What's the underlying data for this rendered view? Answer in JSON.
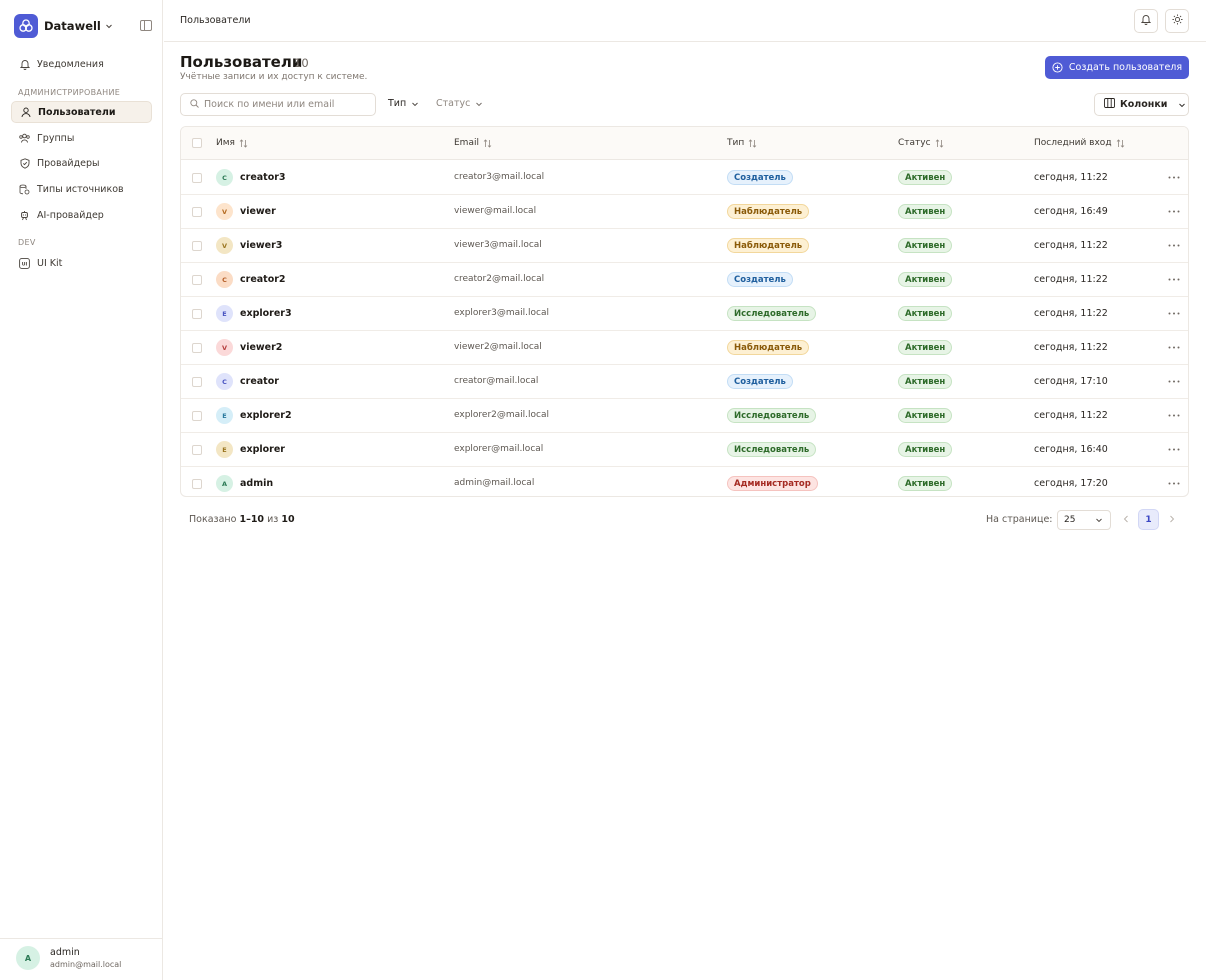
{
  "app": {
    "name": "Datawell"
  },
  "sidebar": {
    "items_top": [
      {
        "label": "Уведомления",
        "icon": "bell-icon"
      }
    ],
    "section_admin": "АДМИНИСТРИРОВАНИЕ",
    "items_admin": [
      {
        "label": "Пользователи",
        "icon": "user-icon",
        "active": true
      },
      {
        "label": "Группы",
        "icon": "group-icon"
      },
      {
        "label": "Провайдеры",
        "icon": "shield-icon"
      },
      {
        "label": "Типы источников",
        "icon": "source-types-icon"
      },
      {
        "label": "AI-провайдер",
        "icon": "ai-icon"
      }
    ],
    "section_dev": "DEV",
    "items_dev": [
      {
        "label": "UI Kit",
        "icon": "ui-kit-icon"
      }
    ],
    "user": {
      "initial": "A",
      "name": "admin",
      "email": "admin@mail.local"
    }
  },
  "topbar": {
    "breadcrumb": "Пользователи"
  },
  "page": {
    "title": "Пользователи",
    "count": "10",
    "subtitle": "Учётные записи и их доступ к системе.",
    "create_button": "Создать пользователя"
  },
  "toolbar": {
    "search_placeholder": "Поиск по имени или email",
    "filter_type": "Тип",
    "filter_status": "Статус",
    "columns_button": "Колонки"
  },
  "table": {
    "headers": {
      "name": "Имя",
      "email": "Email",
      "type": "Тип",
      "status": "Статус",
      "last_login": "Последний вход"
    },
    "rows": [
      {
        "initial": "C",
        "avatar_bg": "#d6f1e4",
        "avatar_fg": "#2c7a55",
        "name": "creator3",
        "email": "creator3@mail.local",
        "type": "Создатель",
        "type_kind": "creator",
        "status": "Активен",
        "last_login": "сегодня, 11:22"
      },
      {
        "initial": "V",
        "avatar_bg": "#fde4cc",
        "avatar_fg": "#b36a20",
        "name": "viewer",
        "email": "viewer@mail.local",
        "type": "Наблюдатель",
        "type_kind": "viewer",
        "status": "Активен",
        "last_login": "сегодня, 16:49"
      },
      {
        "initial": "V",
        "avatar_bg": "#f3e6c4",
        "avatar_fg": "#9a7520",
        "name": "viewer3",
        "email": "viewer3@mail.local",
        "type": "Наблюдатель",
        "type_kind": "viewer",
        "status": "Активен",
        "last_login": "сегодня, 11:22"
      },
      {
        "initial": "C",
        "avatar_bg": "#fbdcc5",
        "avatar_fg": "#b55e28",
        "name": "creator2",
        "email": "creator2@mail.local",
        "type": "Создатель",
        "type_kind": "creator",
        "status": "Активен",
        "last_login": "сегодня, 11:22"
      },
      {
        "initial": "E",
        "avatar_bg": "#dfe3fb",
        "avatar_fg": "#4a55c2",
        "name": "explorer3",
        "email": "explorer3@mail.local",
        "type": "Исследователь",
        "type_kind": "explorer",
        "status": "Активен",
        "last_login": "сегодня, 11:22"
      },
      {
        "initial": "V",
        "avatar_bg": "#fbd9d9",
        "avatar_fg": "#b53c3c",
        "name": "viewer2",
        "email": "viewer2@mail.local",
        "type": "Наблюдатель",
        "type_kind": "viewer",
        "status": "Активен",
        "last_login": "сегодня, 11:22"
      },
      {
        "initial": "C",
        "avatar_bg": "#dfe3fb",
        "avatar_fg": "#4a55c2",
        "name": "creator",
        "email": "creator@mail.local",
        "type": "Создатель",
        "type_kind": "creator",
        "status": "Активен",
        "last_login": "сегодня, 17:10"
      },
      {
        "initial": "E",
        "avatar_bg": "#d5eef8",
        "avatar_fg": "#2a7a9e",
        "name": "explorer2",
        "email": "explorer2@mail.local",
        "type": "Исследователь",
        "type_kind": "explorer",
        "status": "Активен",
        "last_login": "сегодня, 11:22"
      },
      {
        "initial": "E",
        "avatar_bg": "#f3e6c4",
        "avatar_fg": "#9a7520",
        "name": "explorer",
        "email": "explorer@mail.local",
        "type": "Исследователь",
        "type_kind": "explorer",
        "status": "Активен",
        "last_login": "сегодня, 16:40"
      },
      {
        "initial": "A",
        "avatar_bg": "#d6f1e4",
        "avatar_fg": "#2c7a55",
        "name": "admin",
        "email": "admin@mail.local",
        "type": "Администратор",
        "type_kind": "admin",
        "status": "Активен",
        "last_login": "сегодня, 17:20"
      }
    ]
  },
  "badge_colors": {
    "creator": {
      "bg": "#e6f1fc",
      "border": "#c3ddf5",
      "fg": "#1f5f9e"
    },
    "viewer": {
      "bg": "#fdf0d3",
      "border": "#f2d79c",
      "fg": "#8a5a08"
    },
    "explorer": {
      "bg": "#e7f4e6",
      "border": "#c6e3c3",
      "fg": "#2e6b2a"
    },
    "admin": {
      "bg": "#fde4e2",
      "border": "#f5c3bf",
      "fg": "#a52b23"
    },
    "status": {
      "bg": "#e7f4e6",
      "border": "#c6e3c3",
      "fg": "#2e6b2a"
    }
  },
  "footer": {
    "shown_prefix": "Показано",
    "shown_range": "1–10",
    "shown_of": "из",
    "shown_total": "10",
    "per_page_label": "На странице:",
    "per_page_value": "25",
    "current_page": "1"
  },
  "colors": {
    "accent": "#4f5bd5"
  }
}
